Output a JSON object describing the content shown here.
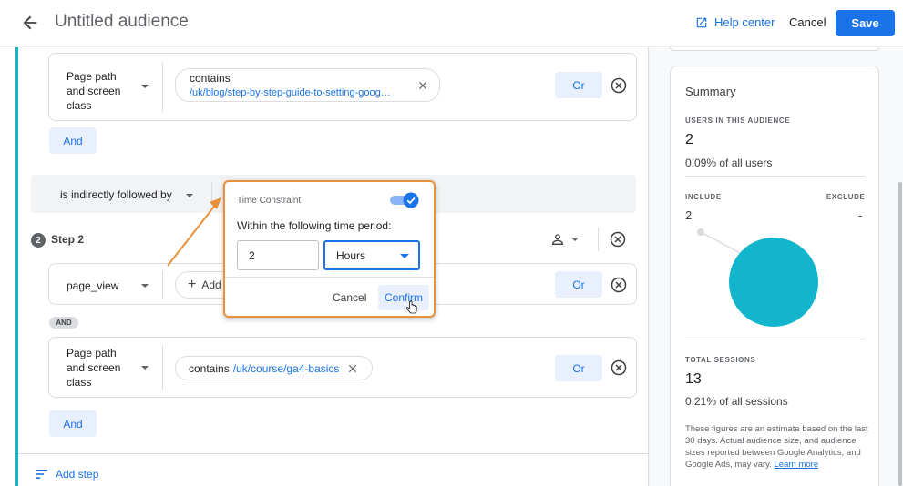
{
  "header": {
    "title": "Untitled audience",
    "help_label": "Help center",
    "cancel_label": "Cancel",
    "save_label": "Save"
  },
  "step1": {
    "condition": {
      "dimension": "Page path and screen class",
      "operator": "contains",
      "value": "/uk/blog/step-by-step-guide-to-setting-goog…",
      "or_label": "Or"
    },
    "and_label": "And"
  },
  "sequence": {
    "relation": "is indirectly followed by"
  },
  "step2": {
    "number": "2",
    "label": "Step 2",
    "condition1": {
      "dimension": "page_view",
      "add_label": "Add",
      "or_label": "Or"
    },
    "and_pill": "AND",
    "condition2": {
      "dimension": "Page path and screen class",
      "operator": "contains",
      "value": "/uk/course/ga4-basics",
      "or_label": "Or"
    },
    "and_label": "And"
  },
  "add_step_label": "Add step",
  "time_constraint": {
    "title": "Time Constraint",
    "enabled": true,
    "subtitle": "Within the following time period:",
    "amount": "2",
    "unit": "Hours",
    "cancel_label": "Cancel",
    "confirm_label": "Confirm"
  },
  "summary": {
    "title": "Summary",
    "users_caption": "USERS IN THIS AUDIENCE",
    "users_value": "2",
    "users_pct": "0.09% of all users",
    "include_caption": "INCLUDE",
    "exclude_caption": "EXCLUDE",
    "include_value": "2",
    "exclude_value": "-",
    "sessions_caption": "TOTAL SESSIONS",
    "sessions_value": "13",
    "sessions_pct": "0.21% of all sessions",
    "note": "These figures are an estimate based on the last 30 days. Actual audience size, and audience sizes reported between Google Analytics, and Google Ads, may vary.",
    "learn_more": "Learn more"
  },
  "colors": {
    "accent": "#1a73e8",
    "rail": "#12b5cb",
    "venn": "#12b5cb",
    "highlight": "#e8913a"
  },
  "icons": [
    "back-arrow-icon",
    "open-in-new-icon",
    "chevron-down-icon",
    "close-icon",
    "cancel-circle-icon",
    "add-icon",
    "person-icon",
    "sort-icon",
    "checkmark-icon",
    "cursor-hand-icon"
  ]
}
